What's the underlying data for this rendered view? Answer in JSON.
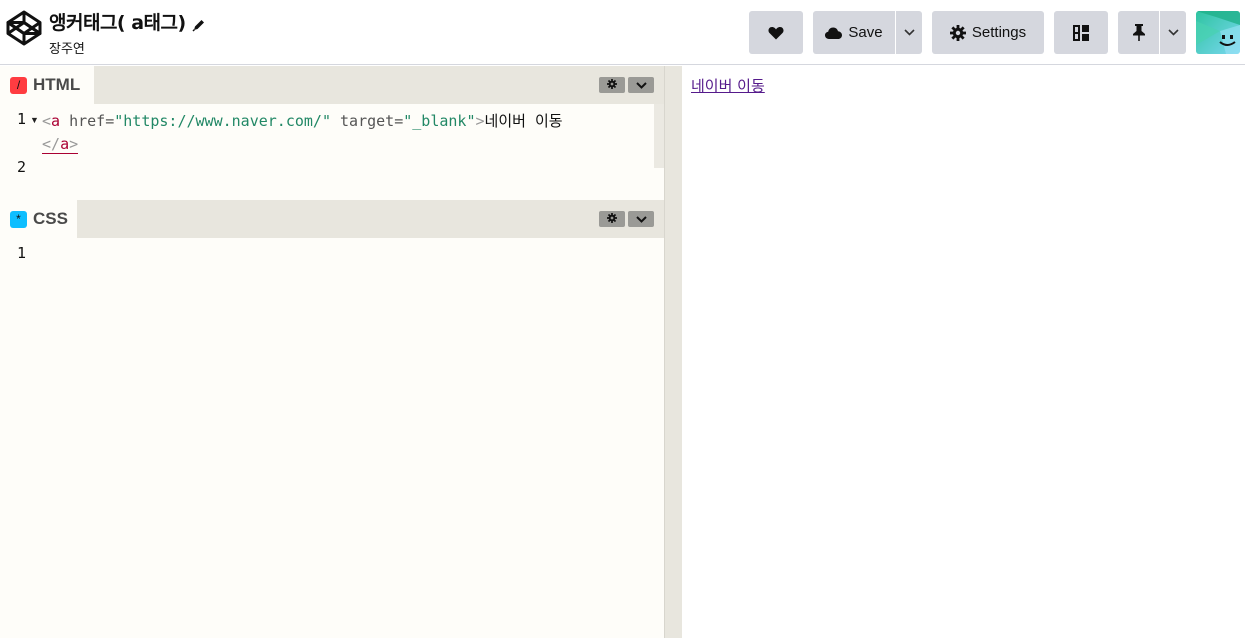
{
  "header": {
    "pen_title": "앵커태그( a태그)",
    "author": "장주연",
    "save_label": "Save",
    "settings_label": "Settings",
    "icons": {
      "logo": "codepen-logo-icon",
      "edit": "pencil-icon",
      "favorite": "heart-icon",
      "save": "cloud-icon",
      "settings": "gear-icon",
      "layout": "layout-icon",
      "pin": "pin-icon",
      "dropdown": "chevron-down-icon"
    }
  },
  "editors": {
    "html": {
      "tab_label": "HTML",
      "icon_glyph": "/",
      "line_numbers": [
        "1",
        "2"
      ],
      "code": {
        "open_lt": "<",
        "tag": "a",
        "attr1": " href=",
        "val1": "\"https://www.naver.com/\"",
        "attr2": " target=",
        "val2": "\"_blank\"",
        "open_gt": ">",
        "text": "네이버 이동",
        "close_lt": "</",
        "close_tag": "a",
        "close_gt": ">"
      }
    },
    "css": {
      "tab_label": "CSS",
      "icon_glyph": "*",
      "line_numbers": [
        "1"
      ]
    }
  },
  "preview": {
    "link_text": "네이버 이동"
  }
}
